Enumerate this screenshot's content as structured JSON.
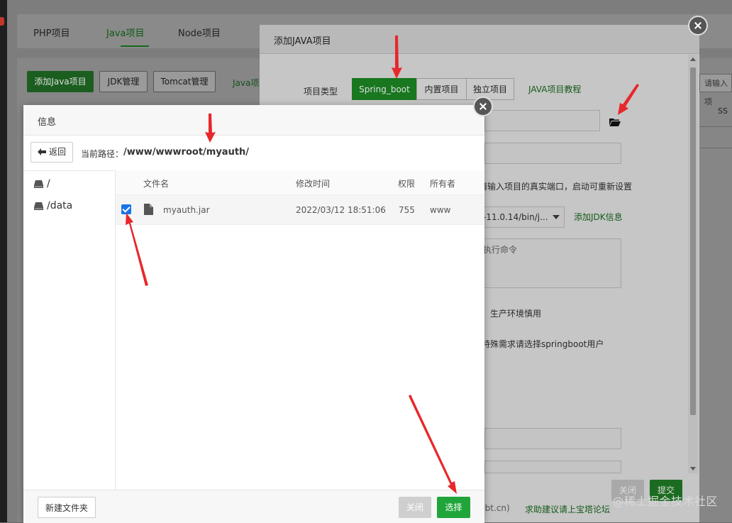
{
  "app": {
    "tabs": [
      "PHP项目",
      "Java项目",
      "Node项目"
    ],
    "active_tab": "Java项目",
    "toolbar": {
      "add_button": "添加Java项目",
      "jdk_button": "JDK管理",
      "tomcat_button": "Tomcat管理",
      "link": "Java项"
    },
    "search_placeholder": "请输入项",
    "column": "SS"
  },
  "java_dialog": {
    "title": "添加JAVA项目",
    "project_type_label": "项目类型",
    "types": [
      "Spring_boot",
      "内置项目",
      "独立项目"
    ],
    "active_type": "Spring_boot",
    "tutorial_link": "JAVA项目教程",
    "port_hint": "请输入项目的真实端口，启动可重新设置",
    "jdk_select_value": "-11.0.14/bin/j...",
    "add_jdk_link": "添加JDK信息",
    "command_placeholder": "执行命令",
    "env_hint": "，生产环境慎用",
    "user_hint": "特殊需求请选择springboot用户",
    "cancel_button": "关闭",
    "submit_button": "提交",
    "footer_text_a": "(bt.cn)",
    "footer_text_b": "求助建议请上宝塔论坛"
  },
  "file_dialog": {
    "title": "信息",
    "back_button": "返回",
    "path_label": "当前路径：",
    "path_value": "/www/wwwroot/myauth/",
    "disks": [
      "/",
      "/data"
    ],
    "columns": [
      "文件名",
      "修改时间",
      "权限",
      "所有者"
    ],
    "rows": [
      {
        "checked": true,
        "name": "myauth.jar",
        "modified": "2022/03/12 18:51:06",
        "perm": "755",
        "owner": "www"
      }
    ],
    "new_folder_button": "新建文件夹",
    "close_button": "关闭",
    "select_button": "选择"
  },
  "watermark": "@稀土掘金技术社区",
  "colors": {
    "primary_green": "#20a53a",
    "annotation_red": "#e8272a",
    "checkbox_blue": "#1a73e8"
  }
}
